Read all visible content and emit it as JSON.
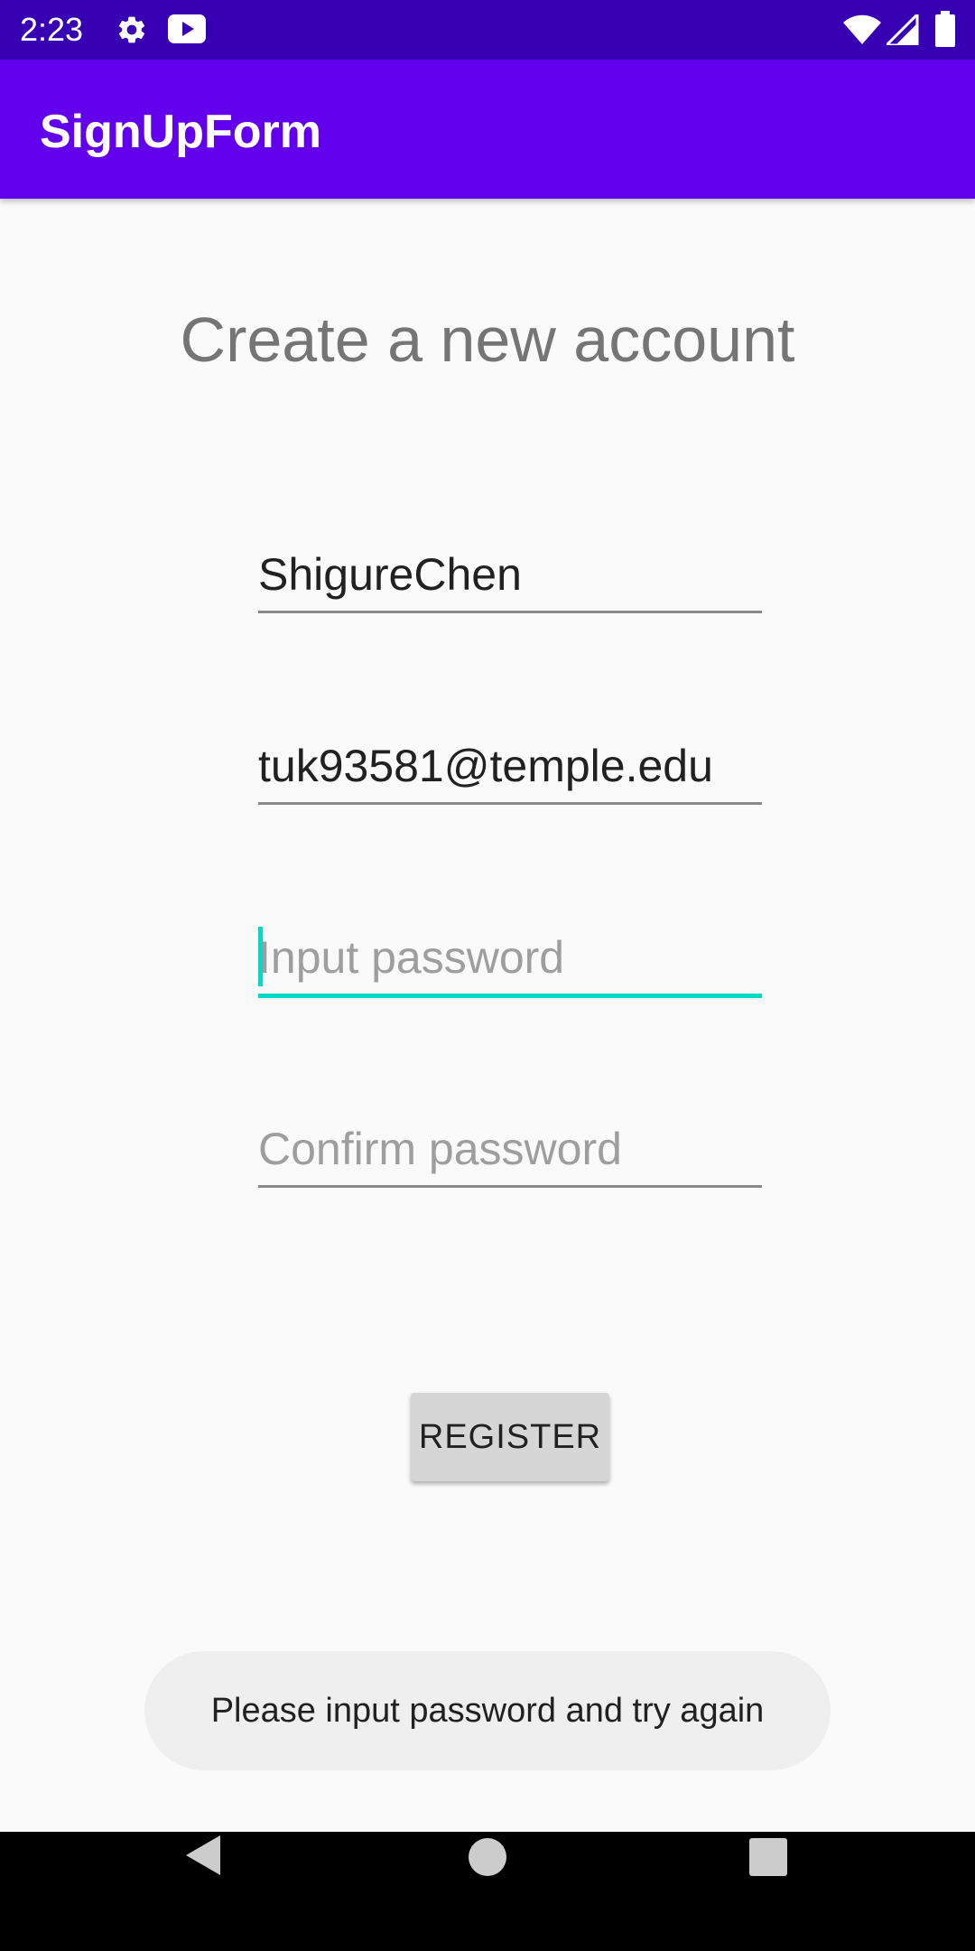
{
  "status_bar": {
    "time": "2:23",
    "icons": [
      "settings-icon",
      "youtube-icon",
      "wifi-icon",
      "signal-icon",
      "battery-icon"
    ]
  },
  "app_bar": {
    "title": "SignUpForm"
  },
  "form": {
    "heading": "Create a new account",
    "name_value": "ShigureChen",
    "email_value": "tuk93581@temple.edu",
    "password_placeholder": "Input password",
    "confirm_placeholder": "Confirm password",
    "register_label": "REGISTER"
  },
  "toast": {
    "message": "Please input password and try again"
  },
  "nav_bar": {
    "icons": [
      "back-icon",
      "home-icon",
      "recents-icon"
    ]
  },
  "colors": {
    "status_bar": "#3700b3",
    "app_bar": "#6200ee",
    "accent": "#03dac5"
  }
}
